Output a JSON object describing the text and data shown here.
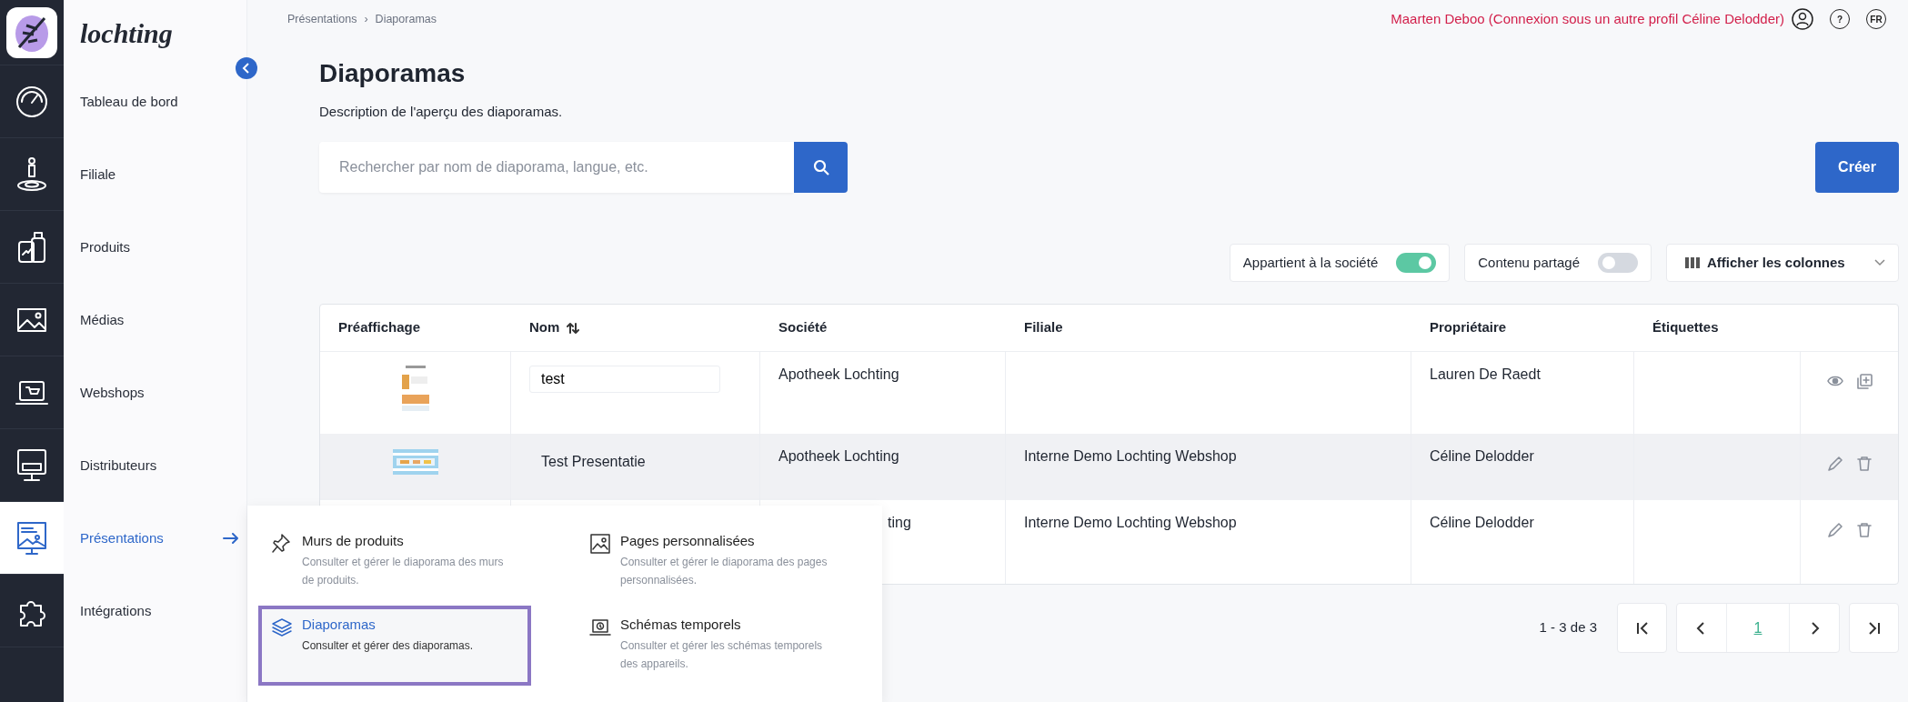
{
  "brand": {
    "logo_text": "lochting"
  },
  "nav": {
    "items": [
      {
        "label": "Tableau de bord",
        "selected": false
      },
      {
        "label": "Filiale",
        "selected": false
      },
      {
        "label": "Produits",
        "selected": false
      },
      {
        "label": "Médias",
        "selected": false
      },
      {
        "label": "Webshops",
        "selected": false
      },
      {
        "label": "Distributeurs",
        "selected": false
      },
      {
        "label": "Présentations",
        "selected": true
      },
      {
        "label": "Intégrations",
        "selected": false
      }
    ]
  },
  "breadcrumb": [
    "Présentations",
    "Diaporamas"
  ],
  "breadcrumb_separator": "›",
  "user": {
    "text": "Maarten Deboo (Connexion sous un autre profil Céline Delodder)",
    "help": "?",
    "language": "FR"
  },
  "page": {
    "title": "Diaporamas",
    "description": "Description de l'aperçu des diaporamas."
  },
  "search": {
    "placeholder": "Rechercher par nom de diaporama, langue, etc."
  },
  "create_button": "Créer",
  "toggles": [
    {
      "label": "Appartient à la société",
      "on": true
    },
    {
      "label": "Contenu partagé",
      "on": false
    }
  ],
  "columns_button": "Afficher les colonnes",
  "table": {
    "columns": [
      {
        "label": "Préaffichage",
        "sortable": false
      },
      {
        "label": "Nom",
        "sortable": true
      },
      {
        "label": "Société",
        "sortable": false
      },
      {
        "label": "Filiale",
        "sortable": false
      },
      {
        "label": "Propriétaire",
        "sortable": false
      },
      {
        "label": "Étiquettes",
        "sortable": false
      }
    ],
    "rows": [
      {
        "preview": {
          "kind": "picture"
        },
        "name": "test",
        "editing": true,
        "societe": "Apotheek Lochting",
        "proprietaire": "Lauren De Raedt",
        "highlighted": false,
        "covered": false,
        "actions": [
          {
            "kind": "view"
          },
          {
            "kind": "duplicate"
          }
        ]
      },
      {
        "preview": {
          "kind": "picture"
        },
        "name": "Test Presentatie",
        "editing": false,
        "societe": "Apotheek Lochting",
        "filiale": "Interne Demo Lochting Webshop",
        "proprietaire": "Céline Delodder",
        "highlighted": true,
        "covered": false,
        "actions": [
          {
            "kind": "edit"
          },
          {
            "kind": "delete"
          }
        ]
      },
      {
        "societe": "ting",
        "filiale": "Interne Demo Lochting Webshop",
        "proprietaire": "Céline Delodder",
        "highlighted": false,
        "covered": true,
        "actions": [
          {
            "kind": "edit"
          },
          {
            "kind": "delete"
          }
        ]
      }
    ]
  },
  "pagination": {
    "range": "1 - 3 de 3",
    "pages": [
      {
        "label": "1",
        "selected": true
      }
    ]
  },
  "menu": {
    "items": [
      {
        "title": "Murs de produits",
        "description": "Consulter et gérer le diaporama des murs de produits.",
        "selected": false
      },
      {
        "title": "Pages personnalisées",
        "description": "Consulter et gérer le diaporama des pages personnalisées.",
        "selected": false
      },
      {
        "title": "Diaporamas",
        "description": "Consulter et gérer des diaporamas.",
        "selected": true
      },
      {
        "title": "Schémas temporels",
        "description": "Consulter et gérer les schémas temporels des appareils.",
        "selected": false
      }
    ]
  }
}
